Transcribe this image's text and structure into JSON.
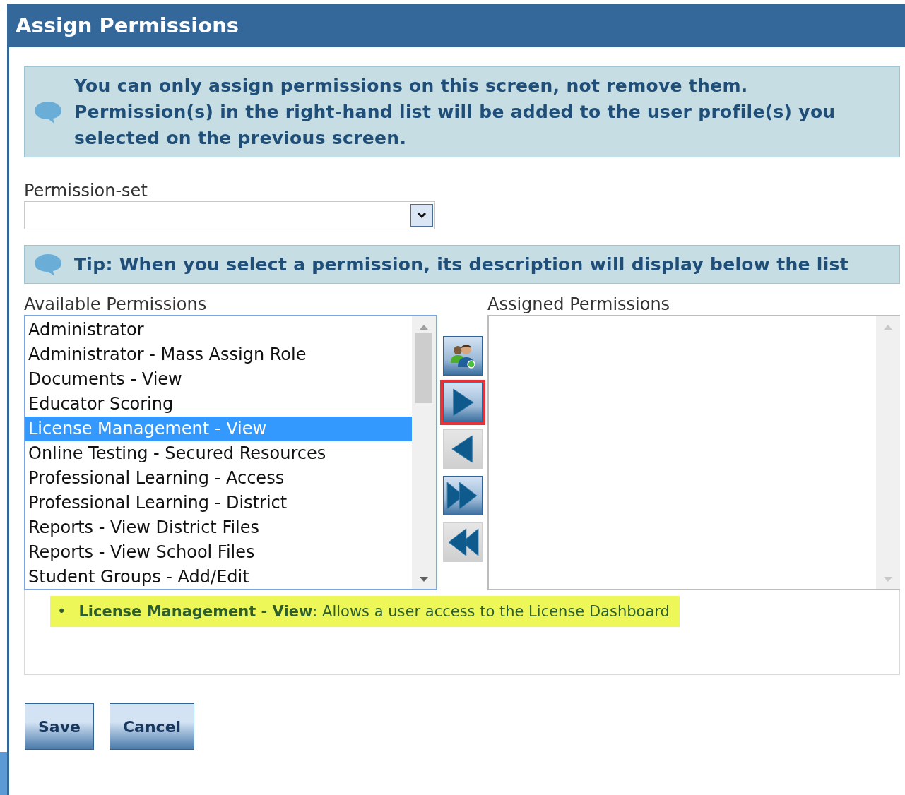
{
  "window": {
    "title": "Assign Permissions"
  },
  "notice": {
    "text": "You can only assign permissions on this screen, not remove them. Permission(s) in the right-hand list will be added to the user profile(s) you selected on the previous screen."
  },
  "permission_set": {
    "label": "Permission-set"
  },
  "tip": {
    "text": "Tip: When you select a permission, its description will display below the list"
  },
  "available": {
    "label": "Available Permissions",
    "items": [
      {
        "text": "Administrator",
        "selected": false
      },
      {
        "text": "Administrator - Mass Assign Role",
        "selected": false
      },
      {
        "text": "Documents - View",
        "selected": false
      },
      {
        "text": "Educator Scoring",
        "selected": false
      },
      {
        "text": "License Management - View",
        "selected": true
      },
      {
        "text": "Online Testing - Secured Resources",
        "selected": false
      },
      {
        "text": "Professional Learning - Access",
        "selected": false
      },
      {
        "text": "Professional Learning - District",
        "selected": false
      },
      {
        "text": "Reports - View District Files",
        "selected": false
      },
      {
        "text": "Reports - View School Files",
        "selected": false
      },
      {
        "text": "Student Groups - Add/Edit",
        "selected": false
      }
    ]
  },
  "transfer_buttons": [
    {
      "kind": "users",
      "disabled": false,
      "highlighted": false
    },
    {
      "kind": "move-right",
      "disabled": false,
      "highlighted": true
    },
    {
      "kind": "move-left",
      "disabled": true,
      "highlighted": false
    },
    {
      "kind": "move-all-right",
      "disabled": false,
      "highlighted": false
    },
    {
      "kind": "move-all-left",
      "disabled": true,
      "highlighted": false
    }
  ],
  "assigned": {
    "label": "Assigned Permissions"
  },
  "description": {
    "bullet": "•",
    "text": "**License Management - View**: Allows a user access to the License Dashboard"
  },
  "buttons": [
    {
      "label": "Save"
    },
    {
      "label": "Cancel"
    }
  ]
}
